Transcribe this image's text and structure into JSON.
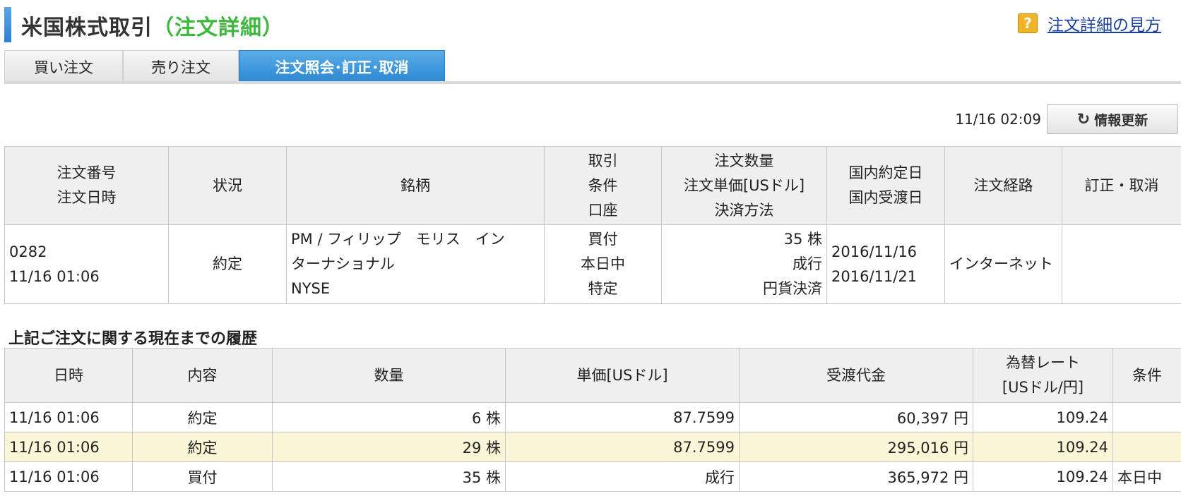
{
  "header": {
    "title": "米国株式取引",
    "subtitle": "（注文詳細）",
    "help_icon": "question-icon",
    "help_link": "注文詳細の見方"
  },
  "tabs": [
    {
      "label": "買い注文"
    },
    {
      "label": "売り注文"
    },
    {
      "label": "注文照会･訂正･取消"
    }
  ],
  "active_tab": 2,
  "toolbar": {
    "timestamp": "11/16 02:09",
    "refresh_label": "情報更新",
    "refresh_icon": "refresh-icon"
  },
  "order_table": {
    "headers": [
      [
        "注文番号",
        "注文日時"
      ],
      [
        "状況"
      ],
      [
        "銘柄"
      ],
      [
        "取引",
        "条件",
        "口座"
      ],
      [
        "注文数量",
        "注文単価[USドル]",
        "決済方法"
      ],
      [
        "国内約定日",
        "国内受渡日"
      ],
      [
        "注文経路"
      ],
      [
        "訂正・取消"
      ]
    ],
    "row": {
      "order_no": "0282",
      "order_datetime": "11/16 01:06",
      "status": "約定",
      "stock_line1": "PM / フィリップ　モリス　イン",
      "stock_line2": "ターナショナル",
      "market": "NYSE",
      "trade": "買付",
      "condition": "本日中",
      "account": "特定",
      "quantity": "35 株",
      "price": "成行",
      "settlement": "円貨決済",
      "contract_date": "2016/11/16",
      "delivery_date": "2016/11/21",
      "route": "インターネット",
      "modify": ""
    }
  },
  "history": {
    "title": "上記ご注文に関する現在までの履歴",
    "headers": [
      [
        "日時"
      ],
      [
        "内容"
      ],
      [
        "数量"
      ],
      [
        "単価[USドル]"
      ],
      [
        "受渡代金"
      ],
      [
        "為替レート",
        "[USドル/円]"
      ],
      [
        "条件"
      ]
    ],
    "rows": [
      {
        "datetime": "11/16 01:06",
        "content": "約定",
        "qty": "6 株",
        "price": "87.7599",
        "amount": "60,397 円",
        "rate": "109.24",
        "cond": ""
      },
      {
        "datetime": "11/16 01:06",
        "content": "約定",
        "qty": "29 株",
        "price": "87.7599",
        "amount": "295,016 円",
        "rate": "109.24",
        "cond": ""
      },
      {
        "datetime": "11/16 01:06",
        "content": "買付",
        "qty": "35 株",
        "price": "成行",
        "amount": "365,972 円",
        "rate": "109.24",
        "cond": "本日中"
      }
    ]
  }
}
